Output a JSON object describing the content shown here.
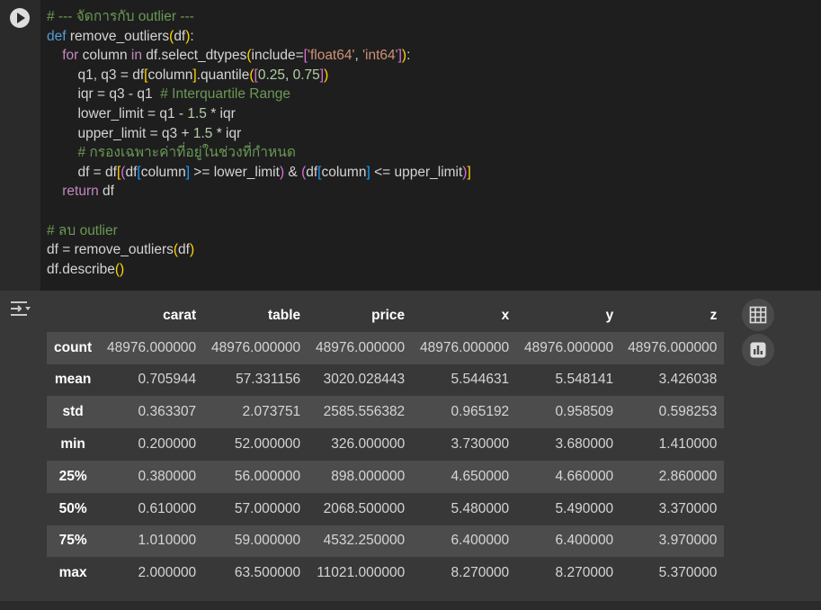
{
  "code_cell": {
    "lines": [
      [
        [
          "cm",
          "# --- จัดการกับ outlier ---"
        ]
      ],
      [
        [
          "kw",
          "def"
        ],
        [
          "",
          " remove_outliers"
        ],
        [
          "b1",
          "("
        ],
        [
          "",
          "df"
        ],
        [
          "b1",
          ")"
        ],
        [
          "",
          ":"
        ]
      ],
      [
        [
          "",
          "    "
        ],
        [
          "kc",
          "for"
        ],
        [
          "",
          " column "
        ],
        [
          "kc",
          "in"
        ],
        [
          "",
          " df.select_dtypes"
        ],
        [
          "b1",
          "("
        ],
        [
          "",
          "include="
        ],
        [
          "b2",
          "["
        ],
        [
          "st",
          "'float64'"
        ],
        [
          "",
          ", "
        ],
        [
          "st",
          "'int64'"
        ],
        [
          "b2",
          "]"
        ],
        [
          "b1",
          ")"
        ],
        [
          "",
          ":"
        ]
      ],
      [
        [
          "",
          "        q1, q3 = df"
        ],
        [
          "b1",
          "["
        ],
        [
          "",
          "column"
        ],
        [
          "b1",
          "]"
        ],
        [
          "",
          ".quantile"
        ],
        [
          "b1",
          "("
        ],
        [
          "b2",
          "["
        ],
        [
          "nu",
          "0.25"
        ],
        [
          "",
          ", "
        ],
        [
          "nu",
          "0.75"
        ],
        [
          "b2",
          "]"
        ],
        [
          "b1",
          ")"
        ]
      ],
      [
        [
          "",
          "        iqr = q3 - q1  "
        ],
        [
          "cm",
          "# Interquartile Range"
        ]
      ],
      [
        [
          "",
          "        lower_limit = q1 - "
        ],
        [
          "nu",
          "1.5"
        ],
        [
          "",
          " * iqr"
        ]
      ],
      [
        [
          "",
          "        upper_limit = q3 + "
        ],
        [
          "nu",
          "1.5"
        ],
        [
          "",
          " * iqr"
        ]
      ],
      [
        [
          "",
          "        "
        ],
        [
          "cm",
          "# กรองเฉพาะค่าที่อยู่ในช่วงที่กำหนด"
        ]
      ],
      [
        [
          "",
          "        df = df"
        ],
        [
          "b1",
          "["
        ],
        [
          "b2",
          "("
        ],
        [
          "",
          "df"
        ],
        [
          "b3",
          "["
        ],
        [
          "",
          "column"
        ],
        [
          "b3",
          "]"
        ],
        [
          "",
          " >= lower_limit"
        ],
        [
          "b2",
          ")"
        ],
        [
          "",
          " & "
        ],
        [
          "b2",
          "("
        ],
        [
          "",
          "df"
        ],
        [
          "b3",
          "["
        ],
        [
          "",
          "column"
        ],
        [
          "b3",
          "]"
        ],
        [
          "",
          " <= upper_limit"
        ],
        [
          "b2",
          ")"
        ],
        [
          "b1",
          "]"
        ]
      ],
      [
        [
          "",
          "    "
        ],
        [
          "kc",
          "return"
        ],
        [
          "",
          " df"
        ]
      ],
      [
        [
          "",
          ""
        ]
      ],
      [
        [
          "cm",
          "# ลบ outlier"
        ]
      ],
      [
        [
          "",
          "df = remove_outliers"
        ],
        [
          "b1",
          "("
        ],
        [
          "",
          "df"
        ],
        [
          "b1",
          ")"
        ]
      ],
      [
        [
          "",
          "df.describe"
        ],
        [
          "b1",
          "()"
        ]
      ]
    ]
  },
  "output": {
    "columns": [
      "carat",
      "table",
      "price",
      "x",
      "y",
      "z"
    ],
    "rows": [
      {
        "label": "count",
        "values": [
          "48976.000000",
          "48976.000000",
          "48976.000000",
          "48976.000000",
          "48976.000000",
          "48976.000000"
        ]
      },
      {
        "label": "mean",
        "values": [
          "0.705944",
          "57.331156",
          "3020.028443",
          "5.544631",
          "5.548141",
          "3.426038"
        ]
      },
      {
        "label": "std",
        "values": [
          "0.363307",
          "2.073751",
          "2585.556382",
          "0.965192",
          "0.958509",
          "0.598253"
        ]
      },
      {
        "label": "min",
        "values": [
          "0.200000",
          "52.000000",
          "326.000000",
          "3.730000",
          "3.680000",
          "1.410000"
        ]
      },
      {
        "label": "25%",
        "values": [
          "0.380000",
          "56.000000",
          "898.000000",
          "4.650000",
          "4.660000",
          "2.860000"
        ]
      },
      {
        "label": "50%",
        "values": [
          "0.610000",
          "57.000000",
          "2068.500000",
          "5.480000",
          "5.490000",
          "3.370000"
        ]
      },
      {
        "label": "75%",
        "values": [
          "1.010000",
          "59.000000",
          "4532.250000",
          "6.400000",
          "6.400000",
          "3.970000"
        ]
      },
      {
        "label": "max",
        "values": [
          "2.000000",
          "63.500000",
          "11021.000000",
          "8.270000",
          "8.270000",
          "5.370000"
        ]
      }
    ]
  },
  "icons": {
    "run": "play-icon",
    "output_toggle": "output-toggle-icon",
    "table": "table-icon",
    "chart": "bar-chart-icon"
  },
  "colors": {
    "comment": "#6a9955",
    "keyword": "#569cd6",
    "control": "#c586c0",
    "string": "#ce9178",
    "number": "#b5cea8",
    "bracket_1": "#ffd700",
    "bracket_2": "#da70d6",
    "bracket_3": "#179fff",
    "stripe": "#4c4c4c"
  }
}
